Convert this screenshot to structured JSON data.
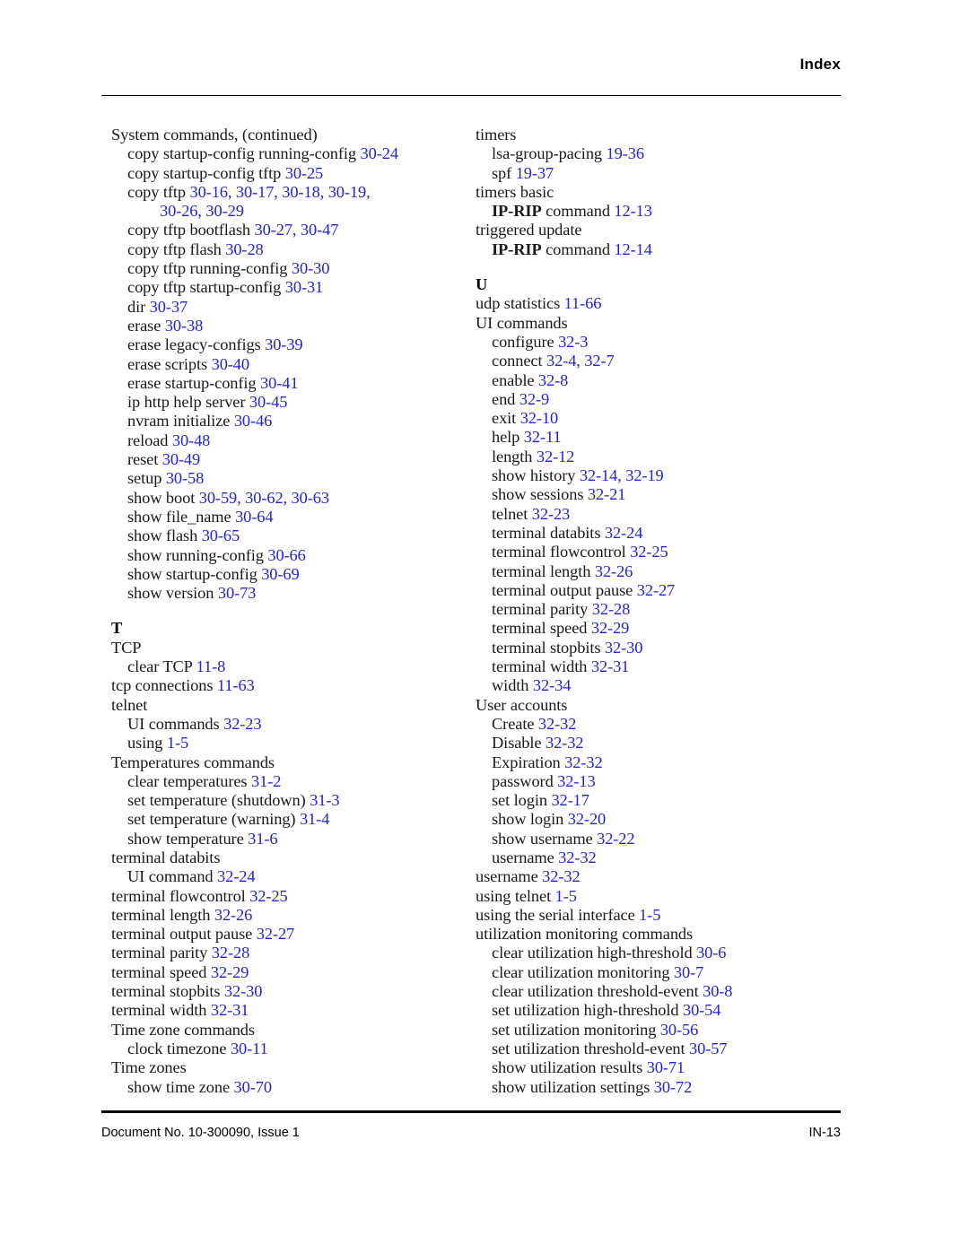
{
  "header": {
    "title": "Index"
  },
  "footer": {
    "document_no": "Document No. 10-300090, Issue 1",
    "page_label": "IN-13"
  },
  "colors": {
    "page_number_blue": "#2323db",
    "text_black": "#1a1a1a",
    "rule_black": "#000000"
  },
  "left_column": [
    {
      "level": 0,
      "text": "System commands, (continued)",
      "pages": ""
    },
    {
      "level": 1,
      "text": "copy startup-config running-config",
      "pages": "30-24"
    },
    {
      "level": 1,
      "text": "copy startup-config tftp",
      "pages": "30-25"
    },
    {
      "level": 1,
      "text": "copy tftp",
      "pages": "30-16, 30-17, 30-18, 30-19,"
    },
    {
      "level": 2,
      "text": "",
      "pages": "30-26, 30-29"
    },
    {
      "level": 1,
      "text": "copy tftp bootflash",
      "pages": "30-27, 30-47"
    },
    {
      "level": 1,
      "text": "copy tftp flash",
      "pages": "30-28"
    },
    {
      "level": 1,
      "text": "copy tftp running-config",
      "pages": "30-30"
    },
    {
      "level": 1,
      "text": "copy tftp startup-config",
      "pages": "30-31"
    },
    {
      "level": 1,
      "text": "dir",
      "pages": "30-37"
    },
    {
      "level": 1,
      "text": "erase",
      "pages": "30-38"
    },
    {
      "level": 1,
      "text": "erase legacy-configs",
      "pages": "30-39"
    },
    {
      "level": 1,
      "text": "erase scripts",
      "pages": "30-40"
    },
    {
      "level": 1,
      "text": "erase startup-config",
      "pages": "30-41"
    },
    {
      "level": 1,
      "text": "ip http help server",
      "pages": "30-45"
    },
    {
      "level": 1,
      "text": "nvram initialize",
      "pages": "30-46"
    },
    {
      "level": 1,
      "text": "reload",
      "pages": "30-48"
    },
    {
      "level": 1,
      "text": "reset",
      "pages": "30-49"
    },
    {
      "level": 1,
      "text": "setup",
      "pages": "30-58"
    },
    {
      "level": 1,
      "text": "show boot",
      "pages": "30-59, 30-62, 30-63"
    },
    {
      "level": 1,
      "text": "show file_name",
      "pages": "30-64"
    },
    {
      "level": 1,
      "text": "show flash",
      "pages": "30-65"
    },
    {
      "level": 1,
      "text": "show running-config",
      "pages": "30-66"
    },
    {
      "level": 1,
      "text": "show startup-config",
      "pages": "30-69"
    },
    {
      "level": 1,
      "text": "show version",
      "pages": "30-73"
    },
    {
      "section_letter": "T"
    },
    {
      "level": 0,
      "text": "TCP",
      "pages": ""
    },
    {
      "level": 1,
      "text": "clear TCP",
      "pages": "11-8"
    },
    {
      "level": 0,
      "text": "tcp connections",
      "pages": "11-63"
    },
    {
      "level": 0,
      "text": "telnet",
      "pages": ""
    },
    {
      "level": 1,
      "text": "UI commands",
      "pages": "32-23"
    },
    {
      "level": 1,
      "text": "using",
      "pages": "1-5"
    },
    {
      "level": 0,
      "text": "Temperatures commands",
      "pages": ""
    },
    {
      "level": 1,
      "text": "clear temperatures",
      "pages": "31-2"
    },
    {
      "level": 1,
      "text": "set temperature (shutdown)",
      "pages": "31-3"
    },
    {
      "level": 1,
      "text": "set temperature (warning)",
      "pages": "31-4"
    },
    {
      "level": 1,
      "text": "show temperature",
      "pages": "31-6"
    },
    {
      "level": 0,
      "text": "terminal databits",
      "pages": ""
    },
    {
      "level": 1,
      "text": "UI command",
      "pages": "32-24"
    },
    {
      "level": 0,
      "text": "terminal flowcontrol",
      "pages": "32-25"
    },
    {
      "level": 0,
      "text": "terminal length",
      "pages": "32-26"
    },
    {
      "level": 0,
      "text": "terminal output pause",
      "pages": "32-27"
    },
    {
      "level": 0,
      "text": "terminal parity",
      "pages": "32-28"
    },
    {
      "level": 0,
      "text": "terminal speed",
      "pages": "32-29"
    },
    {
      "level": 0,
      "text": "terminal stopbits",
      "pages": "32-30"
    },
    {
      "level": 0,
      "text": "terminal width",
      "pages": "32-31"
    },
    {
      "level": 0,
      "text": "Time zone commands",
      "pages": ""
    },
    {
      "level": 1,
      "text": "clock timezone",
      "pages": "30-11"
    },
    {
      "level": 0,
      "text": "Time zones",
      "pages": ""
    },
    {
      "level": 1,
      "text": "show time zone",
      "pages": "30-70"
    }
  ],
  "right_column": [
    {
      "level": 0,
      "text": "timers",
      "pages": ""
    },
    {
      "level": 1,
      "text": "lsa-group-pacing",
      "pages": "19-36"
    },
    {
      "level": 1,
      "text": "spf",
      "pages": "19-37"
    },
    {
      "level": 0,
      "text": "timers basic",
      "pages": ""
    },
    {
      "level": 1,
      "bold_prefix": "IP-RIP",
      "text": " command",
      "pages": "12-13"
    },
    {
      "level": 0,
      "text": "triggered update",
      "pages": ""
    },
    {
      "level": 1,
      "bold_prefix": "IP-RIP",
      "text": " command",
      "pages": "12-14"
    },
    {
      "section_letter": "U"
    },
    {
      "level": 0,
      "text": "udp statistics",
      "pages": "11-66"
    },
    {
      "level": 0,
      "text": "UI commands",
      "pages": ""
    },
    {
      "level": 1,
      "text": "configure",
      "pages": "32-3"
    },
    {
      "level": 1,
      "text": "connect",
      "pages": "32-4, 32-7"
    },
    {
      "level": 1,
      "text": "enable",
      "pages": "32-8"
    },
    {
      "level": 1,
      "text": "end",
      "pages": "32-9"
    },
    {
      "level": 1,
      "text": "exit",
      "pages": "32-10"
    },
    {
      "level": 1,
      "text": "help",
      "pages": "32-11"
    },
    {
      "level": 1,
      "text": "length",
      "pages": "32-12"
    },
    {
      "level": 1,
      "text": "show history",
      "pages": "32-14, 32-19"
    },
    {
      "level": 1,
      "text": "show sessions",
      "pages": "32-21"
    },
    {
      "level": 1,
      "text": "telnet",
      "pages": "32-23"
    },
    {
      "level": 1,
      "text": "terminal databits",
      "pages": "32-24"
    },
    {
      "level": 1,
      "text": "terminal flowcontrol",
      "pages": "32-25"
    },
    {
      "level": 1,
      "text": "terminal length",
      "pages": "32-26"
    },
    {
      "level": 1,
      "text": "terminal output pause",
      "pages": "32-27"
    },
    {
      "level": 1,
      "text": "terminal parity",
      "pages": "32-28"
    },
    {
      "level": 1,
      "text": "terminal speed",
      "pages": "32-29"
    },
    {
      "level": 1,
      "text": "terminal stopbits",
      "pages": "32-30"
    },
    {
      "level": 1,
      "text": "terminal width",
      "pages": "32-31"
    },
    {
      "level": 1,
      "text": "width",
      "pages": "32-34"
    },
    {
      "level": 0,
      "text": "User accounts",
      "pages": ""
    },
    {
      "level": 1,
      "text": "Create",
      "pages": "32-32"
    },
    {
      "level": 1,
      "text": "Disable",
      "pages": "32-32"
    },
    {
      "level": 1,
      "text": "Expiration",
      "pages": "32-32"
    },
    {
      "level": 1,
      "text": "password",
      "pages": "32-13"
    },
    {
      "level": 1,
      "text": "set login",
      "pages": "32-17"
    },
    {
      "level": 1,
      "text": "show login",
      "pages": "32-20"
    },
    {
      "level": 1,
      "text": "show username",
      "pages": "32-22"
    },
    {
      "level": 1,
      "text": "username",
      "pages": "32-32"
    },
    {
      "level": 0,
      "text": "username",
      "pages": "32-32"
    },
    {
      "level": 0,
      "text": "using telnet",
      "pages": "1-5"
    },
    {
      "level": 0,
      "text": "using the serial interface",
      "pages": "1-5"
    },
    {
      "level": 0,
      "text": "utilization monitoring commands",
      "pages": ""
    },
    {
      "level": 1,
      "text": "clear utilization high-threshold",
      "pages": "30-6"
    },
    {
      "level": 1,
      "text": "clear utilization monitoring",
      "pages": "30-7"
    },
    {
      "level": 1,
      "text": "clear utilization threshold-event",
      "pages": "30-8"
    },
    {
      "level": 1,
      "text": "set utilization high-threshold",
      "pages": "30-54"
    },
    {
      "level": 1,
      "text": "set utilization monitoring",
      "pages": "30-56"
    },
    {
      "level": 1,
      "text": "set utilization threshold-event",
      "pages": "30-57"
    },
    {
      "level": 1,
      "text": "show utilization results",
      "pages": "30-71"
    },
    {
      "level": 1,
      "text": "show utilization settings",
      "pages": "30-72"
    }
  ]
}
